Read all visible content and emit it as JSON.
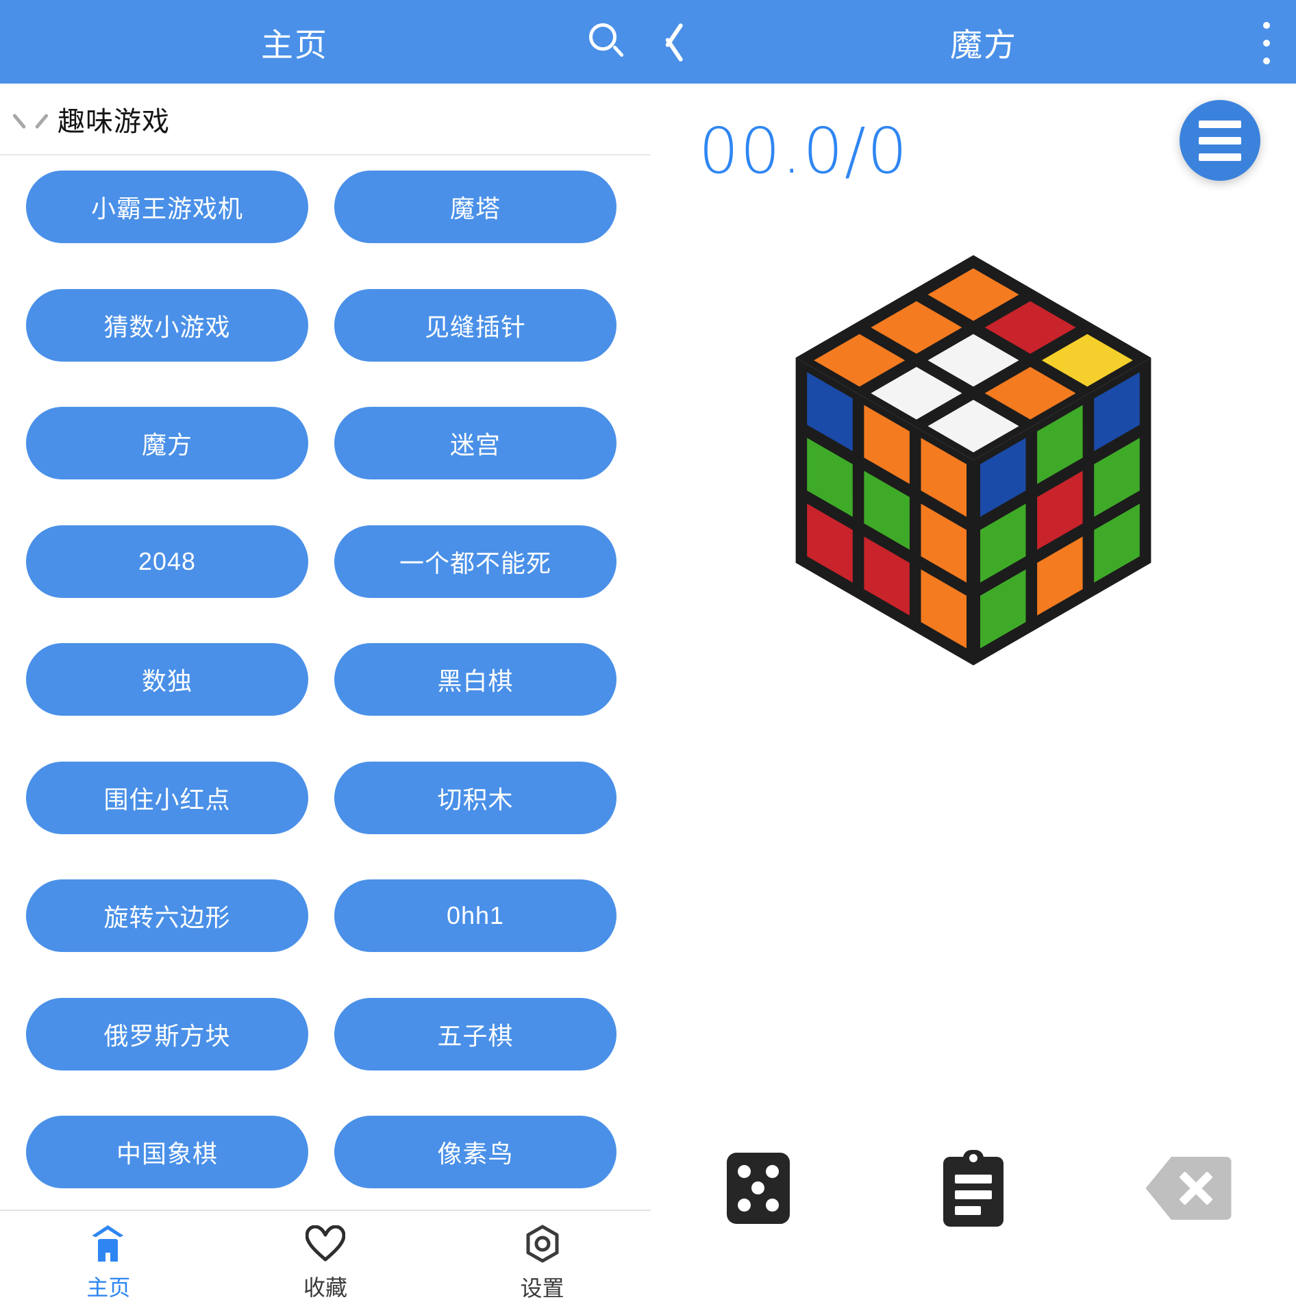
{
  "topbar": {
    "home_label": "主页",
    "title": "魔方",
    "search_icon": "search-icon",
    "back_icon": "back-chevron-icon",
    "overflow_icon": "more-vertical-icon"
  },
  "sidebar": {
    "section_title": "趣味游戏",
    "collapse_icon": "chevron-up-icon",
    "games": [
      "小霸王游戏机",
      "魔塔",
      "猜数小游戏",
      "见缝插针",
      "魔方",
      "迷宫",
      "2048",
      "一个都不能死",
      "数独",
      "黑白棋",
      "围住小红点",
      "切积木",
      "旋转六边形",
      "0hh1",
      "俄罗斯方块",
      "五子棋",
      "中国象棋",
      "像素鸟"
    ]
  },
  "bottom_nav": {
    "items": [
      {
        "label": "主页",
        "icon": "home-icon",
        "active": true
      },
      {
        "label": "收藏",
        "icon": "heart-icon",
        "active": false
      },
      {
        "label": "设置",
        "icon": "gear-icon",
        "active": false
      }
    ]
  },
  "game_panel": {
    "timer": "00.0/0",
    "menu_fab_icon": "hamburger-menu-icon",
    "controls": [
      {
        "name": "scramble",
        "icon": "dice-icon",
        "enabled": true
      },
      {
        "name": "record",
        "icon": "clipboard-icon",
        "enabled": true
      },
      {
        "name": "undo",
        "icon": "backspace-x-icon",
        "enabled": false
      }
    ]
  },
  "colors": {
    "accent": "#4a90e8",
    "topbar": "#4a90e8",
    "nav_active": "#2f86f2",
    "fab": "#3b82dd",
    "timer_text": "#2f86f2",
    "cube_red": "#c9232b",
    "cube_orange": "#f47b20",
    "cube_yellow": "#f5cf2b",
    "cube_white": "#f4f4f4",
    "cube_green": "#3faa28",
    "cube_blue": "#1b4ba8",
    "cube_frame": "#1c1c1c"
  },
  "cube": {
    "type": "rubiks-cube-3x3",
    "up_face": [
      [
        "orange",
        "red",
        "yellow"
      ],
      [
        "orange",
        "white",
        "orange"
      ],
      [
        "orange",
        "white",
        "white"
      ]
    ],
    "front_face": [
      [
        "blue",
        "orange",
        "orange"
      ],
      [
        "green",
        "green",
        "orange"
      ],
      [
        "red",
        "red",
        "orange"
      ]
    ],
    "right_face": [
      [
        "blue",
        "green",
        "blue"
      ],
      [
        "green",
        "red",
        "green"
      ],
      [
        "green",
        "orange",
        "green"
      ]
    ]
  }
}
